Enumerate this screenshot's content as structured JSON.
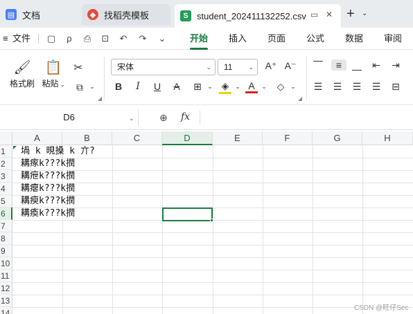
{
  "tabs": [
    {
      "label": "文档",
      "icon": "docs-icon"
    },
    {
      "label": "找稻壳模板",
      "icon": "docer-icon"
    },
    {
      "label": "student_202411132252.csv",
      "icon": "sheet-icon"
    }
  ],
  "menu": {
    "file": "文件",
    "items": [
      "开始",
      "插入",
      "页面",
      "公式",
      "数据",
      "审阅"
    ],
    "active": "开始"
  },
  "ribbon": {
    "format_painter": "格式刷",
    "paste": "粘贴",
    "font_name": "宋体",
    "font_size": "11"
  },
  "formula_bar": {
    "cell_ref": "D6",
    "fx": "fx",
    "content": ""
  },
  "grid": {
    "columns": [
      "A",
      "B",
      "C",
      "D",
      "E",
      "F",
      "G",
      "H"
    ],
    "rows": [
      "1",
      "2",
      "3",
      "4",
      "5",
      "6",
      "7",
      "8",
      "9",
      "10",
      "11",
      "12",
      "13",
      "14"
    ],
    "selected_column": "D",
    "selected_row": "6",
    "cells": [
      "堝 k 晛搡 k 亣?",
      "耩瘃k???k撋",
      "耩疶k???k撋",
      "耩瘪k???k撋",
      "耩瘐k???k撋",
      "耩瘓k???k撋"
    ]
  },
  "watermark": "CSDN @旺仔Sec"
}
